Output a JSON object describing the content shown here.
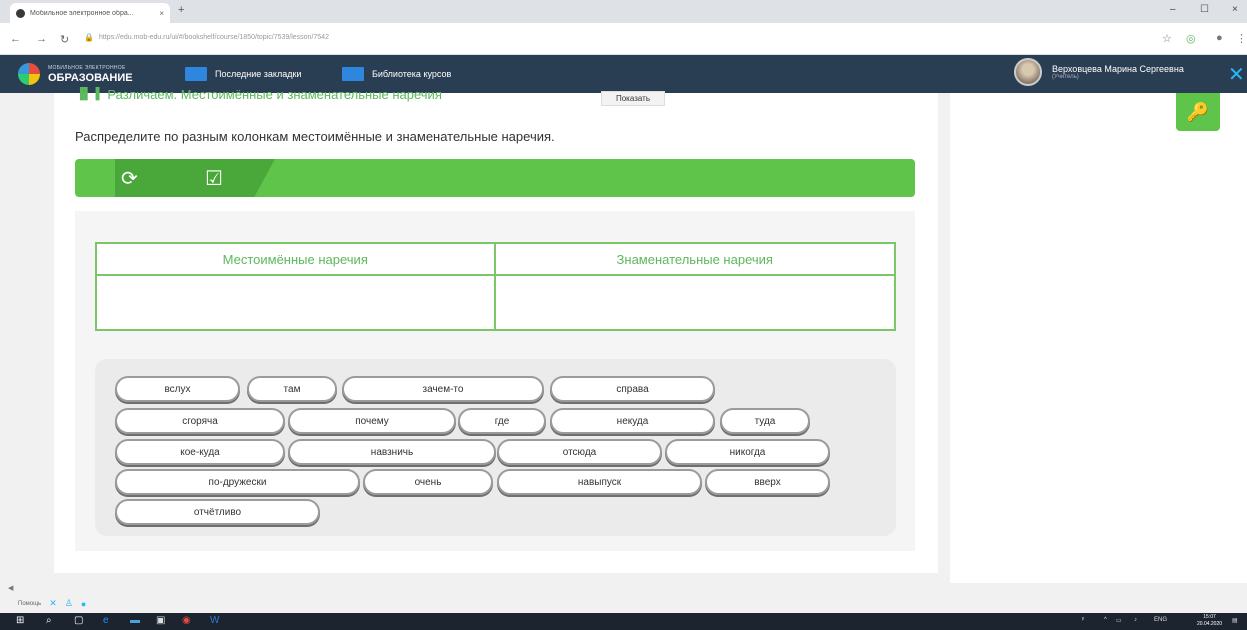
{
  "browser": {
    "tab_title": "Мобильное электронное обра...",
    "tab_close": "×",
    "new_tab": "+",
    "url": "https://edu.mob-edu.ru/ui/#/bookshelf/course/1850/topic/7539/lesson/7542",
    "win_min": "–",
    "win_max": "☐",
    "win_close": "×"
  },
  "header": {
    "logo_small": "МОБИЛЬНОЕ ЭЛЕКТРОННОЕ",
    "logo_big": "ОБРАЗОВАНИЕ",
    "nav_bookmarks": "Последние закладки",
    "nav_library": "Библиотека курсов",
    "user_name": "Верховцева Марина Сергеевна",
    "user_role": "(Учитель)"
  },
  "lesson": {
    "topic_title": "Различаем. Местоимённые и знаменательные наречия",
    "show_button": "Показать",
    "instruction": "Распределите по разным колонкам местоимённые и знаменательные наречия.",
    "col_left": "Местоимённые наречия",
    "col_right": "Знаменательные наречия"
  },
  "chips": [
    "вслух",
    "там",
    "зачем-то",
    "справа",
    "сгоряча",
    "почему",
    "где",
    "некуда",
    "туда",
    "кое-куда",
    "навзничь",
    "отсюда",
    "никогда",
    "по-дружески",
    "очень",
    "навыпуск",
    "вверх",
    "отчётливо"
  ],
  "footer": {
    "help": "Помощь",
    "lang": "ENG",
    "time": "15:07",
    "date": "20.04.2020"
  },
  "colors": {
    "header_bg": "#2a3e53",
    "accent_green": "#5ec44a",
    "text_green": "#5cb85c"
  }
}
